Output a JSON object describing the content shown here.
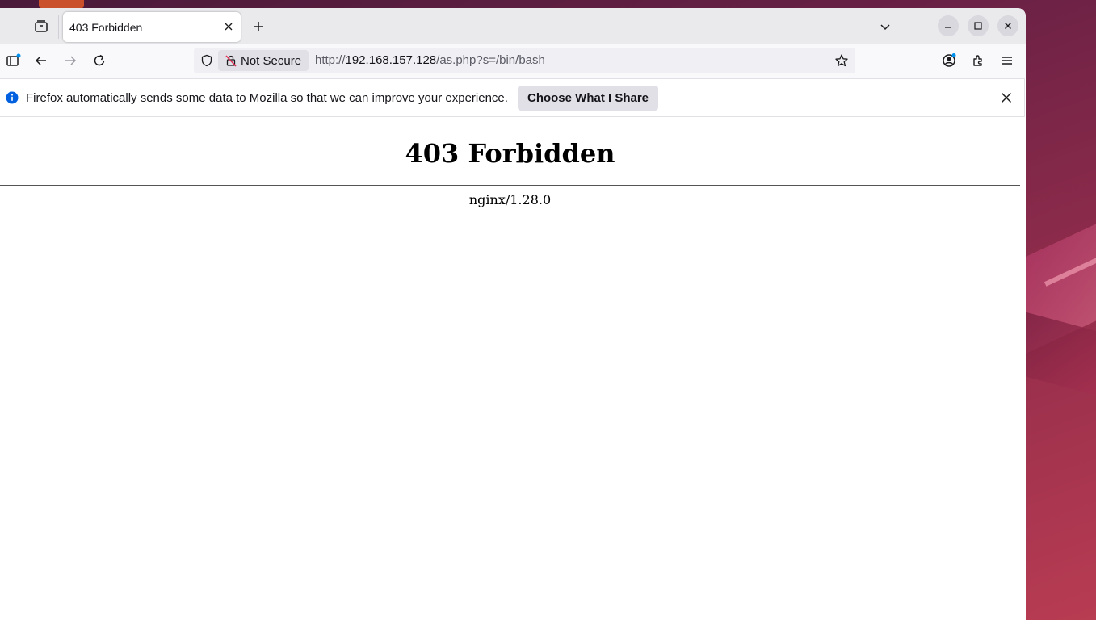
{
  "tab": {
    "title": "403 Forbidden"
  },
  "urlbar": {
    "security_label": "Not Secure",
    "url_scheme": "http://",
    "url_host": "192.168.157.128",
    "url_path": "/as.php?s=/bin/bash"
  },
  "infobar": {
    "message": "Firefox automatically sends some data to Mozilla so that we can improve your experience.",
    "button_label": "Choose What I Share"
  },
  "page": {
    "heading": "403 Forbidden",
    "server": "nginx/1.28.0"
  },
  "colors": {
    "accent_blue": "#0060df",
    "wallpaper": "#8a2a4a"
  }
}
